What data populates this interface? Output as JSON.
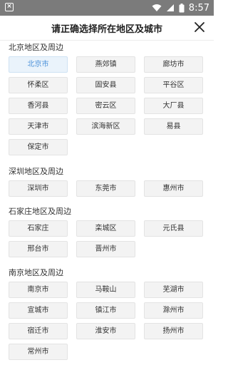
{
  "status_bar": {
    "time": "8:57",
    "left_icon": "x-box-icon",
    "icons": [
      "wifi-icon",
      "signal-icon",
      "battery-icon"
    ]
  },
  "header": {
    "title": "请正确选择所在地区及城市",
    "close_icon": "close-icon"
  },
  "colors": {
    "selected_text": "#4a90d9",
    "selected_bg": "#eaf3fb",
    "button_bg": "#f3f3f3",
    "status_bar_bg": "#7b7b7b"
  },
  "sections": [
    {
      "title": "北京地区及周边",
      "cities": [
        "北京市",
        "燕郊镇",
        "廊坊市",
        "怀柔区",
        "固安县",
        "平谷区",
        "香河县",
        "密云区",
        "大厂县",
        "天津市",
        "滨海新区",
        "易县",
        "保定市"
      ],
      "selected": "北京市"
    },
    {
      "title": "深圳地区及周边",
      "cities": [
        "深圳市",
        "东莞市",
        "惠州市"
      ]
    },
    {
      "title": "石家庄地区及周边",
      "cities": [
        "石家庄",
        "栾城区",
        "元氏县",
        "邢台市",
        "晋州市"
      ]
    },
    {
      "title": "南京地区及周边",
      "cities": [
        "南京市",
        "马鞍山",
        "芜湖市",
        "宣城市",
        "镇江市",
        "滁州市",
        "宿迁市",
        "淮安市",
        "扬州市",
        "常州市"
      ]
    }
  ]
}
